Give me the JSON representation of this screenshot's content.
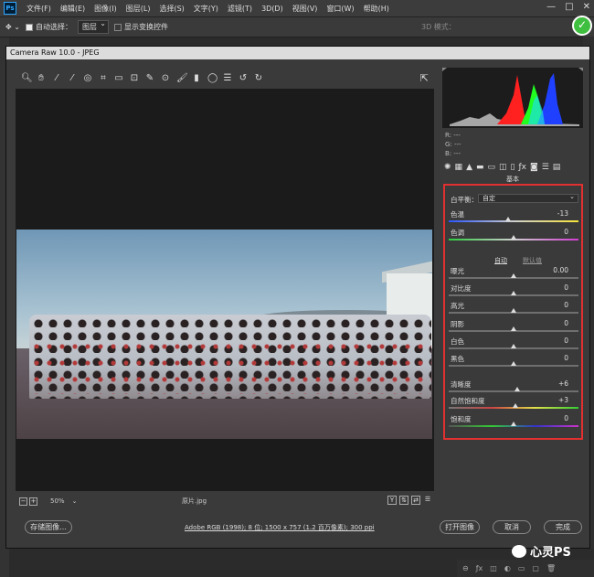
{
  "menubar": {
    "logo": "Ps",
    "items": [
      "文件(F)",
      "编辑(E)",
      "图像(I)",
      "图层(L)",
      "选择(S)",
      "文字(Y)",
      "滤镜(T)",
      "3D(D)",
      "视图(V)",
      "窗口(W)",
      "帮助(H)"
    ],
    "win_controls": [
      "—",
      "□",
      "✕"
    ]
  },
  "optionsbar": {
    "auto_select_label": "自动选择：",
    "auto_select_value": "图层",
    "show_transform_label": "显示变换控件",
    "mode_3d_label": "3D 模式："
  },
  "acr": {
    "title": "Camera Raw 10.0 - JPEG",
    "zoom": "50%",
    "filename": "原片.jpg",
    "workflow": "Adobe RGB (1998); 8 位; 1500 x 757 (1.2 百万像素); 300 ppi",
    "save_image": "存储图像...",
    "open_image": "打开图像",
    "cancel": "取消",
    "done": "完成",
    "rgb_readout": [
      "R:  ---",
      "G:  ---",
      "B:  ---"
    ],
    "panel_title": "基本",
    "basic": {
      "white_balance_label": "白平衡：",
      "white_balance_value": "自定",
      "auto": "自动",
      "default": "默认值",
      "rows": [
        {
          "label": "色温",
          "value": "-13",
          "pos": 0.46
        },
        {
          "label": "色调",
          "value": "0",
          "pos": 0.5
        },
        {
          "label": "曝光",
          "value": "0.00",
          "pos": 0.5
        },
        {
          "label": "对比度",
          "value": "0",
          "pos": 0.5
        },
        {
          "label": "高光",
          "value": "0",
          "pos": 0.5
        },
        {
          "label": "阴影",
          "value": "0",
          "pos": 0.5
        },
        {
          "label": "白色",
          "value": "0",
          "pos": 0.5
        },
        {
          "label": "黑色",
          "value": "0",
          "pos": 0.5
        },
        {
          "label": "清晰度",
          "value": "+6",
          "pos": 0.53
        },
        {
          "label": "自然饱和度",
          "value": "+3",
          "pos": 0.515
        },
        {
          "label": "饱和度",
          "value": "0",
          "pos": 0.5
        }
      ]
    }
  },
  "watermark": "心灵PS",
  "colors": {
    "highlight_box": "#e03030",
    "accent": "#31a8ff"
  }
}
